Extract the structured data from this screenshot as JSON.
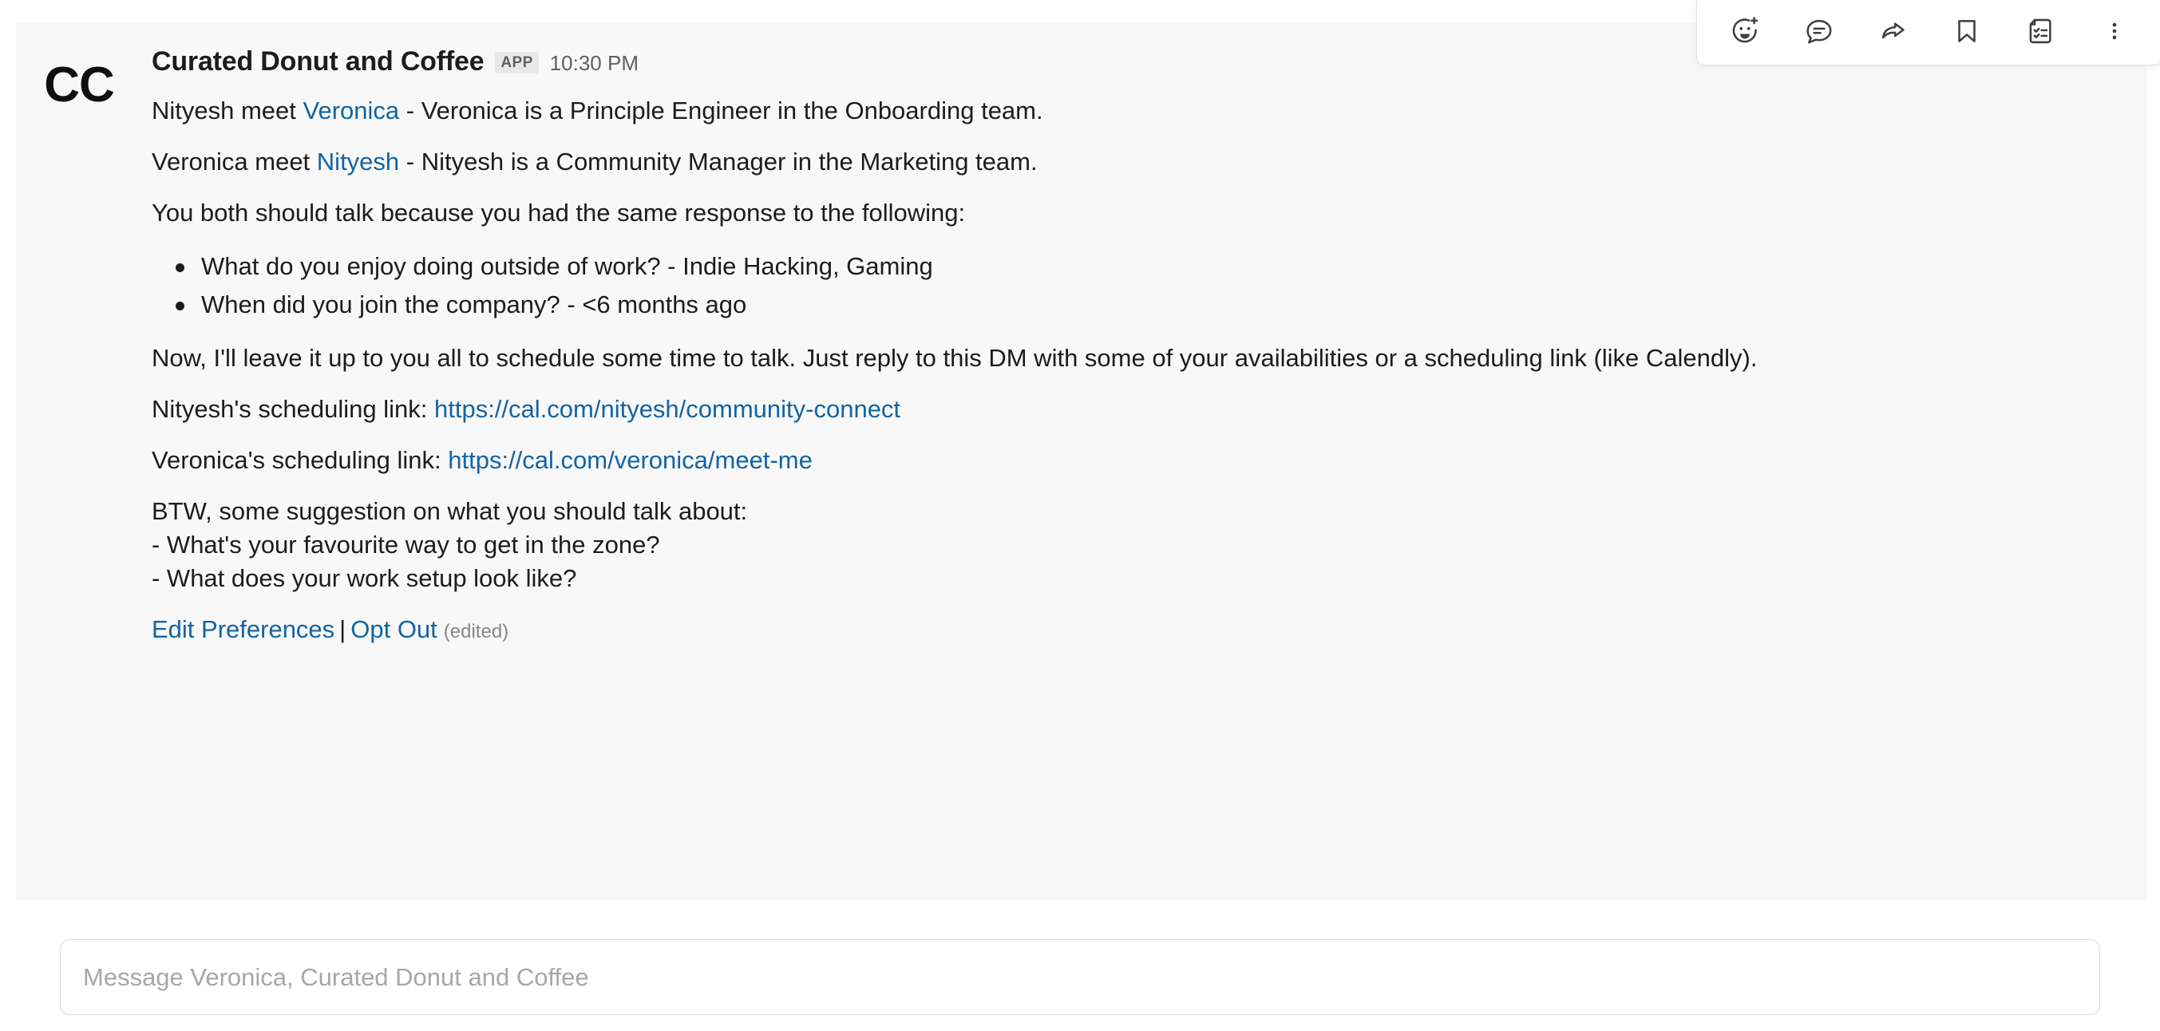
{
  "message": {
    "avatar_initials": "CC",
    "sender_name": "Curated Donut and Coffee",
    "app_badge": "APP",
    "timestamp": "10:30 PM",
    "intro_nityesh": {
      "prefix": "Nityesh meet ",
      "mention": "Veronica",
      "suffix": " - Veronica is a Principle Engineer in the Onboarding team."
    },
    "intro_veronica": {
      "prefix": "Veronica meet ",
      "mention": "Nityesh",
      "suffix": " - Nityesh is a Community Manager in the Marketing team."
    },
    "same_response_intro": "You both should talk because you had the same response to the following:",
    "bullets": [
      "What do you enjoy doing outside of work? - Indie Hacking, Gaming",
      "When did you join the company? - <6 months ago"
    ],
    "schedule_paragraph": "Now, I'll leave it up to you all to schedule some time to talk. Just reply to this DM with some of your availabilities or a scheduling link (like Calendly).",
    "nityesh_link_label": "Nityesh's scheduling link: ",
    "nityesh_link_url": "https://cal.com/nityesh/community-connect",
    "veronica_link_label": "Veronica's scheduling link: ",
    "veronica_link_url": "https://cal.com/veronica/meet-me",
    "suggestions": "BTW, some suggestion on what you should talk about:\n- What's your favourite way to get in the zone?\n- What does your work setup look like?",
    "edit_preferences_label": "Edit Preferences",
    "separator": "|",
    "opt_out_label": "Opt Out",
    "edited_label": "(edited)"
  },
  "toolbar": {
    "items": [
      {
        "name": "add-reaction-icon",
        "label": "Add reaction"
      },
      {
        "name": "reply-in-thread-icon",
        "label": "Reply in thread"
      },
      {
        "name": "forward-message-icon",
        "label": "Forward message"
      },
      {
        "name": "save-for-later-icon",
        "label": "Save for later"
      },
      {
        "name": "add-to-list-icon",
        "label": "Add to list"
      },
      {
        "name": "more-actions-icon",
        "label": "More actions"
      }
    ]
  },
  "composer": {
    "placeholder": "Message Veronica, Curated Donut and Coffee",
    "value": ""
  },
  "colors": {
    "link": "#1264a3",
    "text": "#1d1c1d",
    "muted": "#616061",
    "hover_bg": "#f8f8f8"
  }
}
